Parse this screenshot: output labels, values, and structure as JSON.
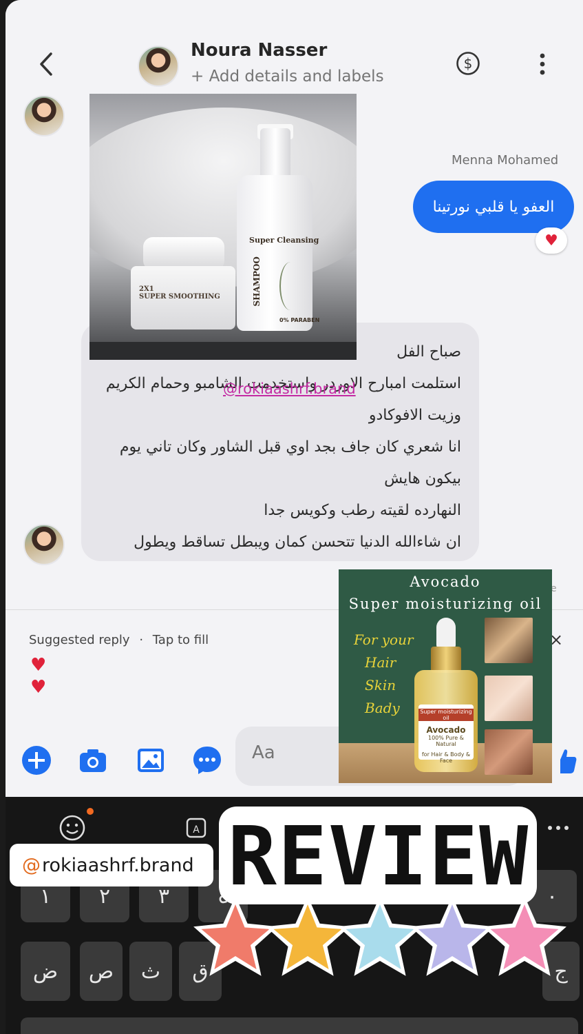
{
  "header": {
    "name": "Noura Nasser",
    "subtitle": "+ Add details and labels"
  },
  "conversation": {
    "sender_label": "Menna Mohamed",
    "sent_message": "العفو يا قلبي نورتينا",
    "reaction": "♥",
    "received_lines": [
      "صباح الفل",
      "استلمت امبارح الاوردر واستخدمت الشامبو وحمام الكريم",
      "وزيت الافوكادو",
      "انا شعري كان جاف بجد اوي قبل الشاور وكان تاني يوم",
      "بيكون هايش",
      "النهارده لقيته رطب وكويس جدا",
      "ان شاءالله الدنيا تتحسن كمان ويبطل تساقط ويطول"
    ],
    "watermark": "@rokiaashrf.brand",
    "seen_fragment": "e"
  },
  "product_photo": {
    "jar_label": [
      "2X1",
      "SUPER SMOOTHING"
    ],
    "bottle_title": "Super Cleansing",
    "bottle_type": "SHAMPOO",
    "bottle_badge": "0% PARABEN"
  },
  "suggested": {
    "label": "Suggested reply",
    "separator": "·",
    "hint": "Tap to fill",
    "replies": [
      "♥",
      "♥"
    ],
    "close": "×"
  },
  "composer": {
    "placeholder": "Aa"
  },
  "poster": {
    "title_line1": "Avocado",
    "title_line2": "Super moisturizing oil",
    "uses": [
      "For your",
      "Hair",
      "Skin",
      "Bady"
    ],
    "bottle_label": [
      "Super moisturizing oil",
      "Avocado",
      "100% Pure & Natural",
      "for Hair & Body & Face"
    ]
  },
  "keyboard": {
    "row1": [
      "١",
      "٢",
      "٣",
      "٤",
      "٠"
    ],
    "row2": [
      "ض",
      "ص",
      "ث",
      "ق",
      "ج"
    ]
  },
  "overlay": {
    "handle": "rokiaashrf.brand",
    "handle_prefix": "@",
    "review": "REVIEW",
    "star_colors": [
      "#f07b6a",
      "#f4b63a",
      "#a9dcec",
      "#b9b6ea",
      "#f48eb6"
    ]
  }
}
